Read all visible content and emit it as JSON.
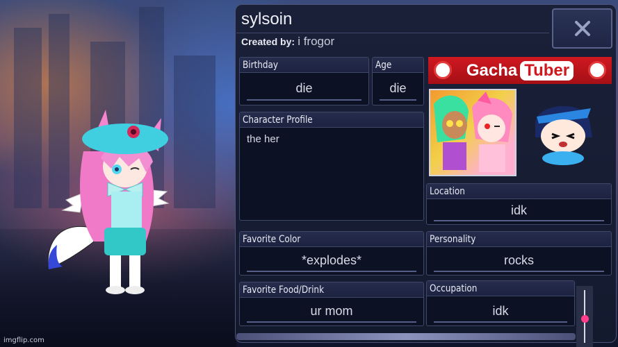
{
  "watermark": "imgflip.com",
  "profile": {
    "name": "sylsoin",
    "created_by_label": "Created by:",
    "created_by_value": "i frogor"
  },
  "fields": {
    "birthday": {
      "label": "Birthday",
      "value": "die"
    },
    "age": {
      "label": "Age",
      "value": "die"
    },
    "character_profile": {
      "label": "Character Profile",
      "value": "the her"
    },
    "location": {
      "label": "Location",
      "value": "idk"
    },
    "favorite_color": {
      "label": "Favorite Color",
      "value": "*explodes*"
    },
    "personality": {
      "label": "Personality",
      "value": "rocks"
    },
    "favorite_food": {
      "label": "Favorite Food/Drink",
      "value": "ur mom"
    },
    "occupation": {
      "label": "Occupation",
      "value": "idk"
    }
  },
  "banner": {
    "word1": "Gacha",
    "word2": "Tuber"
  },
  "slider": {
    "level": 0.5
  },
  "icons": {
    "close": "close-icon"
  },
  "colors": {
    "panel": "#141a2e",
    "accent": "#ff3d8a",
    "banner": "#d01820"
  }
}
